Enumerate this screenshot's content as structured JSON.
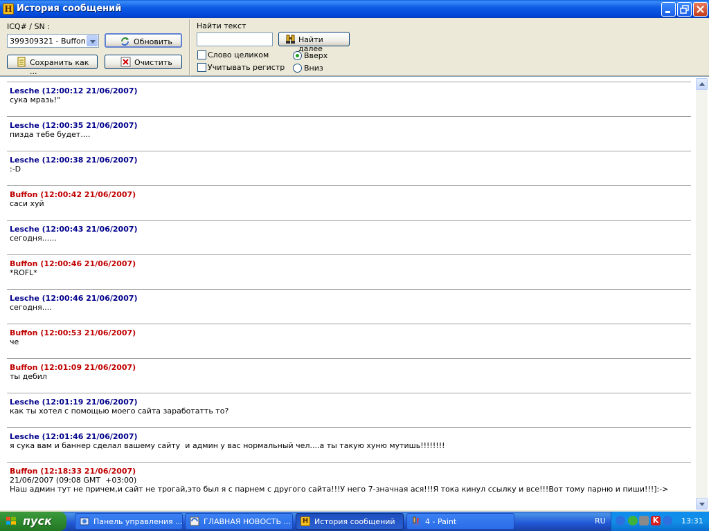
{
  "window": {
    "title": "История сообщений"
  },
  "toolbar": {
    "icq_label": "ICQ# / SN :",
    "contact_selected": "399309321 - Buffon",
    "refresh_label": "Обновить",
    "save_as_label": "Сохранить как ...",
    "clear_label": "Очистить",
    "find_label": "Найти текст",
    "find_value": "",
    "find_next_label": "Найти далее",
    "whole_word_label": "Слово целиком",
    "match_case_label": "Учитывать регистр",
    "dir_up_label": "Вверх",
    "dir_down_label": "Вниз",
    "whole_word_checked": false,
    "match_case_checked": false,
    "direction": "up"
  },
  "messages": [
    {
      "sender": "Lesche",
      "color": "blue",
      "header": "Lesche (12:00:12 21/06/2007)",
      "text": "сука мразь!\""
    },
    {
      "sender": "Lesche",
      "color": "blue",
      "header": "Lesche (12:00:35 21/06/2007)",
      "text": "пизда тебе будет...."
    },
    {
      "sender": "Lesche",
      "color": "blue",
      "header": "Lesche (12:00:38 21/06/2007)",
      "text": ":-D"
    },
    {
      "sender": "Buffon",
      "color": "red",
      "header": "Buffon (12:00:42 21/06/2007)",
      "text": "саси хуй"
    },
    {
      "sender": "Lesche",
      "color": "blue",
      "header": "Lesche (12:00:43 21/06/2007)",
      "text": "сегодня......"
    },
    {
      "sender": "Buffon",
      "color": "red",
      "header": "Buffon (12:00:46 21/06/2007)",
      "text": "*ROFL*"
    },
    {
      "sender": "Lesche",
      "color": "blue",
      "header": "Lesche (12:00:46 21/06/2007)",
      "text": "сегодня...."
    },
    {
      "sender": "Buffon",
      "color": "red",
      "header": "Buffon (12:00:53 21/06/2007)",
      "text": "че"
    },
    {
      "sender": "Buffon",
      "color": "red",
      "header": "Buffon (12:01:09 21/06/2007)",
      "text": "ты дебил"
    },
    {
      "sender": "Lesche",
      "color": "blue",
      "header": "Lesche (12:01:19 21/06/2007)",
      "text": "как ты хотел с помощью моего сайта заработатть то?"
    },
    {
      "sender": "Lesche",
      "color": "blue",
      "header": "Lesche (12:01:46 21/06/2007)",
      "text": "я сука вам и баннер сделал вашему сайту  и админ у вас нормальный чел....а ты такую хуню мутишь!!!!!!!!"
    },
    {
      "sender": "Buffon",
      "color": "red",
      "header": "Buffon (12:18:33 21/06/2007)",
      "text": "21/06/2007 (09:08 GMT  +03:00)\nНаш админ тут не причем,и сайт не трогай,это был я с парнем с другого сайта!!!У него 7-значная ася!!!Я тока кинул ссылку и все!!!Вот тому парню и пиши!!!]:->"
    }
  ],
  "taskbar": {
    "start_label": "пуск",
    "tasks": [
      {
        "label": "Панель управления ...",
        "active": false
      },
      {
        "label": "ГЛАВНАЯ НОВОСТЬ ...",
        "active": false
      },
      {
        "label": "История сообщений",
        "active": true
      },
      {
        "label": "4 - Paint",
        "active": false
      }
    ],
    "language": "RU",
    "clock": "13:31"
  },
  "colors": {
    "blue_sender": "#00008b",
    "red_sender": "#c00000",
    "titlebar": "#0054e3",
    "face": "#ece9d8"
  }
}
